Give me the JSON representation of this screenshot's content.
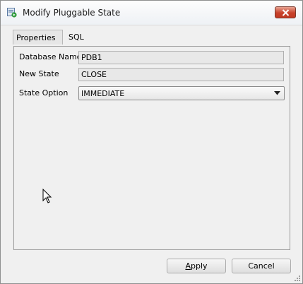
{
  "window": {
    "title": "Modify Pluggable State",
    "icon": "pluggable-db-icon",
    "close_icon": "close-icon"
  },
  "tabs": [
    {
      "label": "Properties",
      "selected": true
    },
    {
      "label": "SQL",
      "selected": false
    }
  ],
  "form": {
    "database_name": {
      "label": "Database Name",
      "value": "PDB1"
    },
    "new_state": {
      "label": "New State",
      "value": "CLOSE"
    },
    "state_option": {
      "label": "State Option",
      "value": "IMMEDIATE"
    }
  },
  "buttons": {
    "apply": {
      "label_mnemonic": "A",
      "label_rest": "pply"
    },
    "cancel": {
      "label": "Cancel"
    }
  },
  "colors": {
    "close_button": "#c8412b",
    "panel_bg": "#f0f0f0",
    "accent_icon": "#2e9a3a"
  }
}
